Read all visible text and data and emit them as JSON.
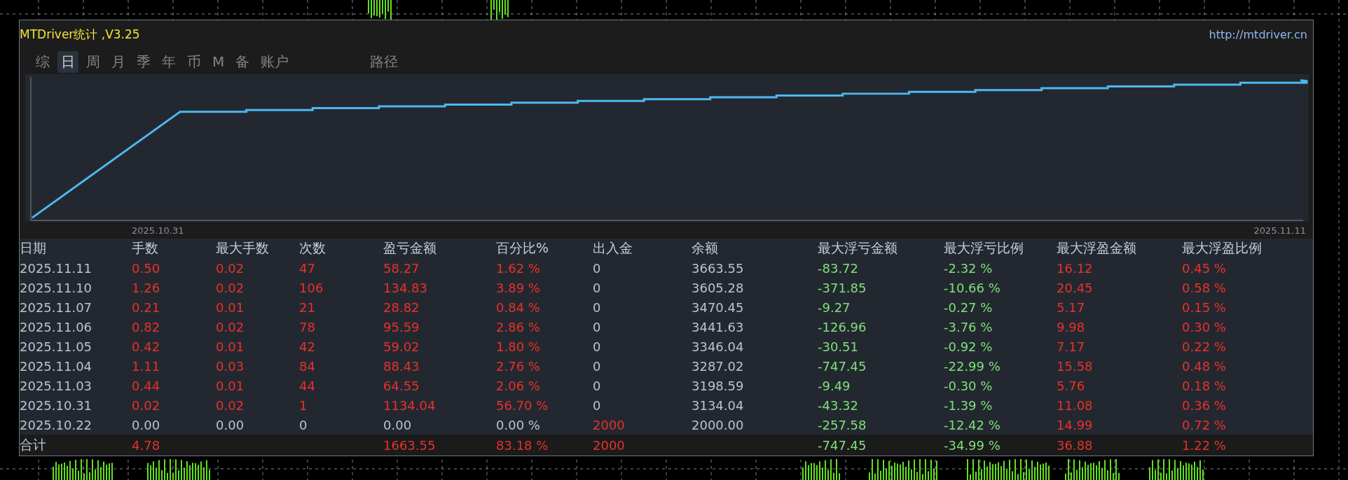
{
  "window": {
    "title": "MTDriver统计 ,V3.25",
    "url": "http://mtdriver.cn"
  },
  "tabs": [
    {
      "label": "综",
      "selected": false
    },
    {
      "label": "日",
      "selected": true
    },
    {
      "label": "周",
      "selected": false
    },
    {
      "label": "月",
      "selected": false
    },
    {
      "label": "季",
      "selected": false
    },
    {
      "label": "年",
      "selected": false
    },
    {
      "label": "币",
      "selected": false
    },
    {
      "label": "M",
      "selected": false
    },
    {
      "label": "备",
      "selected": false
    },
    {
      "label": "账户",
      "selected": false
    }
  ],
  "path_button": {
    "label": "路径"
  },
  "chart": {
    "start_label": "2025.10.31",
    "end_label": "2025.11.11"
  },
  "table": {
    "columns": [
      {
        "label": "日期",
        "kind": "date"
      },
      {
        "label": "手数",
        "kind": "profit"
      },
      {
        "label": "最大手数",
        "kind": "profit"
      },
      {
        "label": "次数",
        "kind": "profit"
      },
      {
        "label": "盈亏金额",
        "kind": "profit"
      },
      {
        "label": "百分比%",
        "kind": "profit"
      },
      {
        "label": "出入金",
        "kind": "cashflow"
      },
      {
        "label": "余额",
        "kind": "plain"
      },
      {
        "label": "最大浮亏金额",
        "kind": "loss"
      },
      {
        "label": "最大浮亏比例",
        "kind": "loss"
      },
      {
        "label": "最大浮盈金额",
        "kind": "float_profit"
      },
      {
        "label": "最大浮盈比例",
        "kind": "float_profit"
      }
    ],
    "rows": [
      {
        "kind": "day",
        "cells": [
          "2025.11.11",
          "0.50",
          "0.02",
          "47",
          "58.27",
          "1.62 %",
          "0",
          "3663.55",
          "-83.72",
          "-2.32 %",
          "16.12",
          "0.45 %"
        ]
      },
      {
        "kind": "day",
        "cells": [
          "2025.11.10",
          "1.26",
          "0.02",
          "106",
          "134.83",
          "3.89 %",
          "0",
          "3605.28",
          "-371.85",
          "-10.66 %",
          "20.45",
          "0.58 %"
        ]
      },
      {
        "kind": "day",
        "cells": [
          "2025.11.07",
          "0.21",
          "0.01",
          "21",
          "28.82",
          "0.84 %",
          "0",
          "3470.45",
          "-9.27",
          "-0.27 %",
          "5.17",
          "0.15 %"
        ]
      },
      {
        "kind": "day",
        "cells": [
          "2025.11.06",
          "0.82",
          "0.02",
          "78",
          "95.59",
          "2.86 %",
          "0",
          "3441.63",
          "-126.96",
          "-3.76 %",
          "9.98",
          "0.30 %"
        ]
      },
      {
        "kind": "day",
        "cells": [
          "2025.11.05",
          "0.42",
          "0.01",
          "42",
          "59.02",
          "1.80 %",
          "0",
          "3346.04",
          "-30.51",
          "-0.92 %",
          "7.17",
          "0.22 %"
        ]
      },
      {
        "kind": "day",
        "cells": [
          "2025.11.04",
          "1.11",
          "0.03",
          "84",
          "88.43",
          "2.76 %",
          "0",
          "3287.02",
          "-747.45",
          "-22.99 %",
          "15.58",
          "0.48 %"
        ]
      },
      {
        "kind": "day",
        "cells": [
          "2025.11.03",
          "0.44",
          "0.01",
          "44",
          "64.55",
          "2.06 %",
          "0",
          "3198.59",
          "-9.49",
          "-0.30 %",
          "5.76",
          "0.18 %"
        ]
      },
      {
        "kind": "day",
        "cells": [
          "2025.10.31",
          "0.02",
          "0.02",
          "1",
          "1134.04",
          "56.70 %",
          "0",
          "3134.04",
          "-43.32",
          "-1.39 %",
          "11.08",
          "0.36 %"
        ]
      },
      {
        "kind": "deposit",
        "cells": [
          "2025.10.22",
          "0.00",
          "0.00",
          "0",
          "0.00",
          "0.00 %",
          "2000",
          "2000.00",
          "-257.58",
          "-12.42 %",
          "14.99",
          "0.72 %"
        ]
      }
    ],
    "total": {
      "kind": "total",
      "cells": [
        "合计",
        "4.78",
        null,
        null,
        "1663.55",
        "83.18 %",
        "2000",
        null,
        "-747.45",
        "-34.99 %",
        "36.88",
        "1.22 %"
      ]
    }
  }
}
